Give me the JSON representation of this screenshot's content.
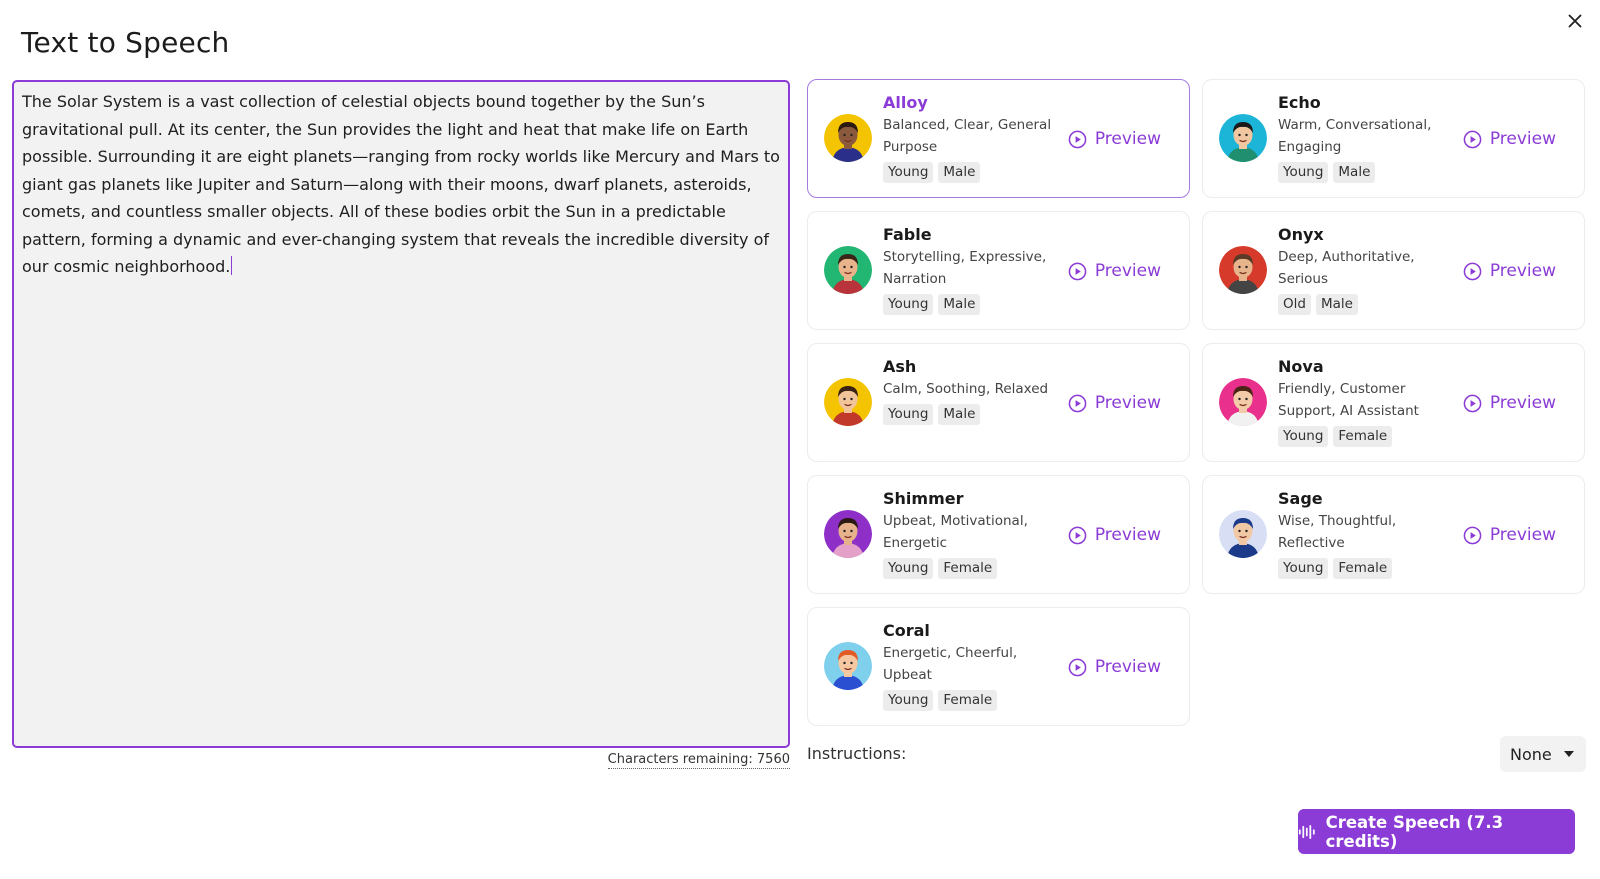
{
  "dialog": {
    "title": "Text to Speech",
    "close_icon": "close-icon"
  },
  "editor": {
    "text": "The Solar System is a vast collection of celestial objects bound together by the Sun’s gravitational pull. At its center, the Sun provides the light and heat that make life on Earth possible. Surrounding it are eight planets—ranging from rocky worlds like Mercury and Mars to giant gas planets like Jupiter and Saturn—along with their moons, dwarf planets, asteroids, comets, and countless smaller objects. All of these bodies orbit the Sun in a predictable pattern, forming a dynamic and ever-changing system that reveals the incredible diversity of our cosmic neighborhood.",
    "chars_remaining": "Characters remaining: 7560"
  },
  "voices": [
    {
      "name": "Alloy",
      "desc": "Balanced, Clear, General Purpose",
      "tags": [
        "Young",
        "Male"
      ],
      "preview": "Preview",
      "selected": true,
      "avatar_bg": "#f4c400",
      "skin": "#8b5a3c",
      "hair": "#2a1a10",
      "shirt": "#2a2f8a"
    },
    {
      "name": "Echo",
      "desc": "Warm, Conversational, Engaging",
      "tags": [
        "Young",
        "Male"
      ],
      "preview": "Preview",
      "selected": false,
      "avatar_bg": "#1cb5d8",
      "skin": "#f0c7a0",
      "hair": "#1a1a1a",
      "shirt": "#1f8f6f"
    },
    {
      "name": "Fable",
      "desc": "Storytelling, Expressive, Narration",
      "tags": [
        "Young",
        "Male"
      ],
      "preview": "Preview",
      "selected": false,
      "avatar_bg": "#22b673",
      "skin": "#e9b48c",
      "hair": "#3a2418",
      "shirt": "#b8333a"
    },
    {
      "name": "Onyx",
      "desc": "Deep, Authoritative, Serious",
      "tags": [
        "Old",
        "Male"
      ],
      "preview": "Preview",
      "selected": false,
      "avatar_bg": "#d63a2a",
      "skin": "#e7b58c",
      "hair": "#5a3a26",
      "shirt": "#444444"
    },
    {
      "name": "Ash",
      "desc": "Calm, Soothing, Relaxed",
      "tags": [
        "Young",
        "Male"
      ],
      "preview": "Preview",
      "selected": false,
      "avatar_bg": "#f4c400",
      "skin": "#f1c49a",
      "hair": "#3b2212",
      "shirt": "#c0392b"
    },
    {
      "name": "Nova",
      "desc": "Friendly, Customer Support, AI Assistant",
      "tags": [
        "Young",
        "Female"
      ],
      "preview": "Preview",
      "selected": false,
      "avatar_bg": "#e8308c",
      "skin": "#f3cba8",
      "hair": "#4a2414",
      "shirt": "#f1f1f1"
    },
    {
      "name": "Shimmer",
      "desc": "Upbeat, Motivational, Energetic",
      "tags": [
        "Young",
        "Female"
      ],
      "preview": "Preview",
      "selected": false,
      "avatar_bg": "#8e2fc8",
      "skin": "#e6b28c",
      "hair": "#2a1a14",
      "shirt": "#e4a0c8"
    },
    {
      "name": "Sage",
      "desc": "Wise, Thoughtful, Reflective",
      "tags": [
        "Young",
        "Female"
      ],
      "preview": "Preview",
      "selected": false,
      "avatar_bg": "#d8dff5",
      "skin": "#f1c8a4",
      "hair": "#1b3a8a",
      "shirt": "#1b3a8a"
    },
    {
      "name": "Coral",
      "desc": "Energetic, Cheerful, Upbeat",
      "tags": [
        "Young",
        "Female"
      ],
      "preview": "Preview",
      "selected": false,
      "avatar_bg": "#7fd0ec",
      "skin": "#f5c8a2",
      "hair": "#e25a24",
      "shirt": "#2a4fd1"
    }
  ],
  "instructions": {
    "label": "Instructions:",
    "selected": "None"
  },
  "create_button": {
    "label": "Create Speech (7.3 credits)",
    "icon": "waveform-icon"
  },
  "colors": {
    "accent": "#8b3bd6",
    "editor_bg": "#f2f2f2",
    "tag_bg": "#ececec"
  }
}
